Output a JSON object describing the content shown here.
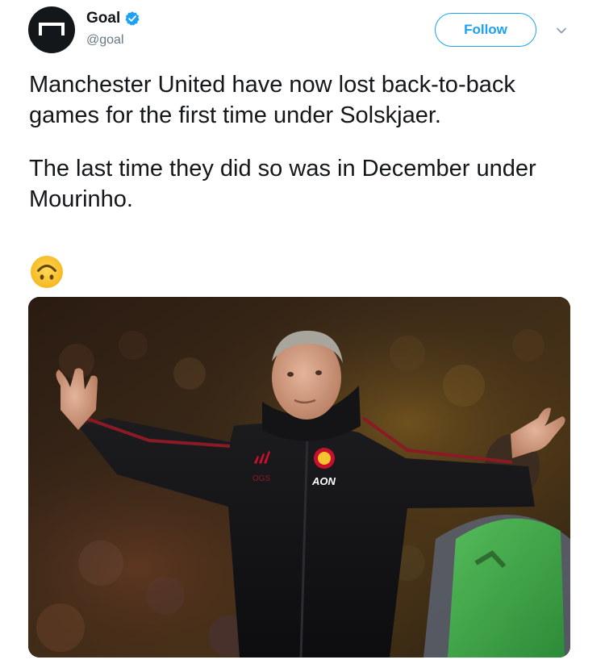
{
  "author": {
    "display_name": "Goal",
    "handle": "@goal",
    "verified": true,
    "avatar_icon": "goal-logo-icon",
    "verified_icon": "verified-badge-icon"
  },
  "actions": {
    "follow_label": "Follow",
    "more_icon": "chevron-down-icon"
  },
  "tweet": {
    "paragraphs": [
      "Manchester United have now lost back-to-back games for the first time under Solskjaer.",
      "The last time they did so was in December under Mourinho."
    ],
    "emoji": "upside-down-face-emoji"
  },
  "media": {
    "jacket_sponsor": "AON",
    "jacket_initials": "OGS"
  },
  "colors": {
    "accent": "#1da1f2",
    "text": "#14171a",
    "secondary": "#657786",
    "emoji": "#f7c325"
  }
}
